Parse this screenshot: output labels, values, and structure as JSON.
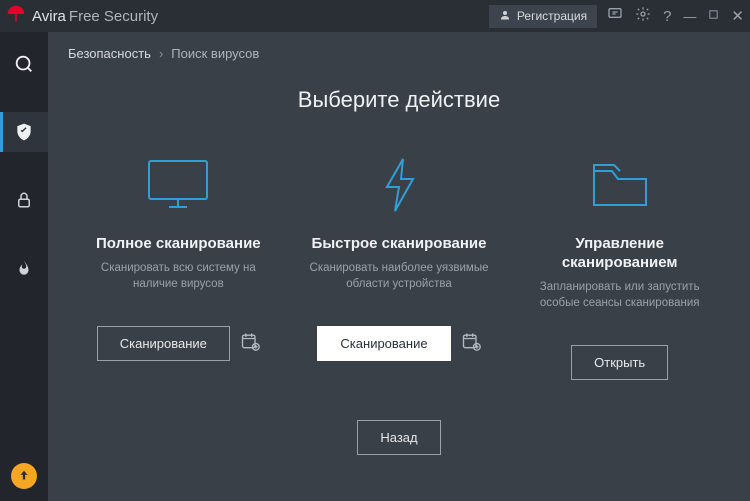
{
  "titlebar": {
    "brand_main": "Avira",
    "brand_sub": "Free Security",
    "register_label": "Регистрация"
  },
  "breadcrumb": {
    "root": "Безопасность",
    "sub": "Поиск вирусов"
  },
  "page_title": "Выберите действие",
  "cards": {
    "full": {
      "title": "Полное сканирование",
      "desc": "Сканировать всю систему на наличие вирусов",
      "button": "Сканирование"
    },
    "quick": {
      "title": "Быстрое сканирование",
      "desc": "Сканировать наиболее уязвимые области устройства",
      "button": "Сканирование"
    },
    "manage": {
      "title": "Управление сканированием",
      "desc": "Запланировать или запустить особые сеансы сканирования",
      "button": "Открыть"
    }
  },
  "back_label": "Назад"
}
